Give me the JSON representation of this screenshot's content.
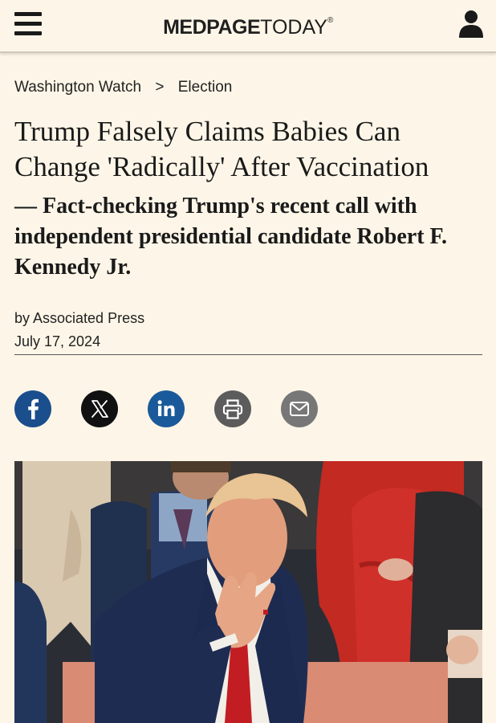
{
  "header": {
    "logo_bold": "MEDPAGE",
    "logo_light": "TODAY",
    "logo_mark": "®"
  },
  "breadcrumb": {
    "section": "Washington Watch",
    "separator": ">",
    "subsection": "Election"
  },
  "article": {
    "headline": "Trump Falsely Claims Babies Can Change 'Radically' After Vaccination",
    "subheadline": "— Fact-checking Trump's recent call with independent presidential candidate Robert F. Kennedy Jr.",
    "byline": "by Associated Press",
    "date": "July 17, 2024"
  },
  "share": {
    "icons": [
      "facebook-icon",
      "x-icon",
      "linkedin-icon",
      "print-icon",
      "email-icon"
    ],
    "colors": {
      "facebook": "#1a4e8c",
      "x": "#111111",
      "linkedin": "#1b5a9a",
      "print": "#5c5c5c",
      "email": "#777777"
    }
  },
  "theme": {
    "background": "#fdf6e8",
    "accent_blue": "#1a4e8c"
  }
}
